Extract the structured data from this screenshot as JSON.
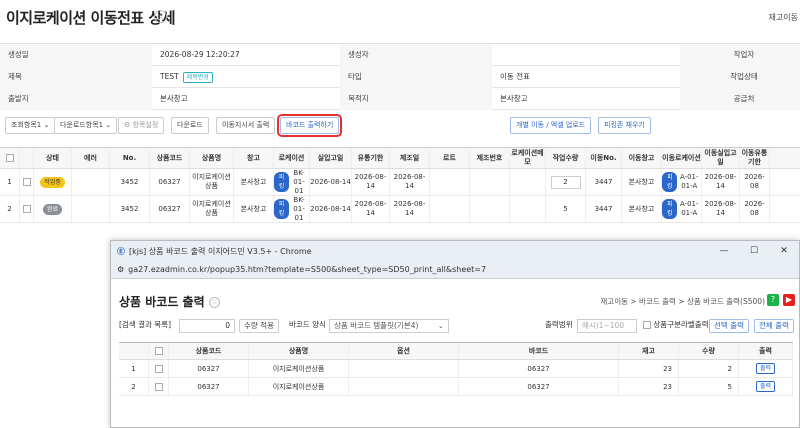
{
  "page": {
    "title": "이지로케이션 이동전표 상세",
    "top_right": "재고이동"
  },
  "info": {
    "rows": [
      [
        {
          "l": "생성일"
        },
        {
          "v": "2026-08-29 12:20:27"
        },
        {
          "l": "생성자"
        },
        {
          "v": ""
        },
        {
          "l": "작업자"
        },
        {
          "v": ""
        }
      ],
      [
        {
          "l": "제목"
        },
        {
          "v": "TEST"
        },
        {
          "l": "타입"
        },
        {
          "v": "이동 전표"
        },
        {
          "l": "작업상태"
        },
        {
          "v": ""
        }
      ],
      [
        {
          "l": "출발지"
        },
        {
          "v": "본사창고"
        },
        {
          "l": "목적지"
        },
        {
          "v": "본사창고"
        },
        {
          "l": "공급처"
        },
        {
          "v": ""
        }
      ]
    ],
    "title_edit_label": "제목변경"
  },
  "toolbar": {
    "query1": "조회항목1",
    "query2": "다운로드항목1",
    "column_setting": "항목설정",
    "download": "다운로드",
    "print_instruction": "이동지시서 출력",
    "barcode_print": "바코드 출력하기",
    "upload": "개별 이동 / 엑셀 업로드",
    "fill_picking": "피킹존 채우기"
  },
  "grid": {
    "headers": [
      "상태",
      "에러",
      "No.",
      "상품코드",
      "상품명",
      "창고",
      "로케이션",
      "실입고일",
      "유통기한",
      "제조일",
      "로트",
      "제조번호",
      "로케이션메모",
      "작업수량",
      "이동No.",
      "이동창고",
      "이동로케이션",
      "이동실입고일",
      "이동유통기한"
    ],
    "rows": [
      {
        "idx": "1",
        "status": "작업중",
        "no": "3452",
        "code": "06327",
        "name": "이지로케이션 상품",
        "wh": "본사창고",
        "loc_tag": "피킹",
        "loc": "BK-01-01",
        "in": "2026-08-14",
        "exp": "2026-08-14",
        "mfg": "2026-08-14",
        "qty": "2",
        "mno": "3447",
        "mwh": "본사창고",
        "mloc_tag": "피킹",
        "mloc": "A-01-01-A",
        "min": "2026-08-14",
        "mexp": "2026-08"
      },
      {
        "idx": "2",
        "status": "완료",
        "no": "3452",
        "code": "06327",
        "name": "이지로케이션 상품",
        "wh": "본사창고",
        "loc_tag": "피킹",
        "loc": "BK-01-01",
        "in": "2026-08-14",
        "exp": "2026-08-14",
        "mfg": "2026-08-14",
        "qty": "5",
        "mno": "3447",
        "mwh": "본사창고",
        "mloc_tag": "피킹",
        "mloc": "A-01-01-A",
        "min": "2026-08-14",
        "mexp": "2026-08"
      }
    ]
  },
  "popup": {
    "window_title": "[kjs] 상품 바코드 출력 이지어드민 V3.5+ - Chrome",
    "url": "ga27.ezadmin.co.kr/popup35.htm?template=S500&sheet_type=SD50_print_all&sheet=7",
    "title": "상품 바코드 출력",
    "breadcrumb": "재고이동  >  바코드 출력  >  상품 바코드 출력(S500)",
    "search_result_label": "[검색 결과 목록]",
    "qty_value": "0",
    "qty_apply": "수량 적용",
    "barcode_format_label": "바코드 양식",
    "barcode_format_value": "상품 바코드 템플릿(기본4)",
    "range_label": "출력범위",
    "range_placeholder": "예시)1~100",
    "separator_label": "상품구분라벨출력",
    "print_selected": "선택 출력",
    "print_all": "전체 출력",
    "headers": [
      "상품코드",
      "상품명",
      "옵션",
      "바코드",
      "재고",
      "수량",
      "출력"
    ],
    "rows": [
      {
        "idx": "1",
        "code": "06327",
        "name": "이지로케이션상품",
        "option": "",
        "barcode": "06327",
        "stock": "23",
        "qty": "2",
        "print": "출력"
      },
      {
        "idx": "2",
        "code": "06327",
        "name": "이지로케이션상품",
        "option": "",
        "barcode": "06327",
        "stock": "23",
        "qty": "5",
        "print": "출력"
      }
    ],
    "colors": {
      "help": "#19b24b",
      "youtube": "#e52020"
    }
  }
}
